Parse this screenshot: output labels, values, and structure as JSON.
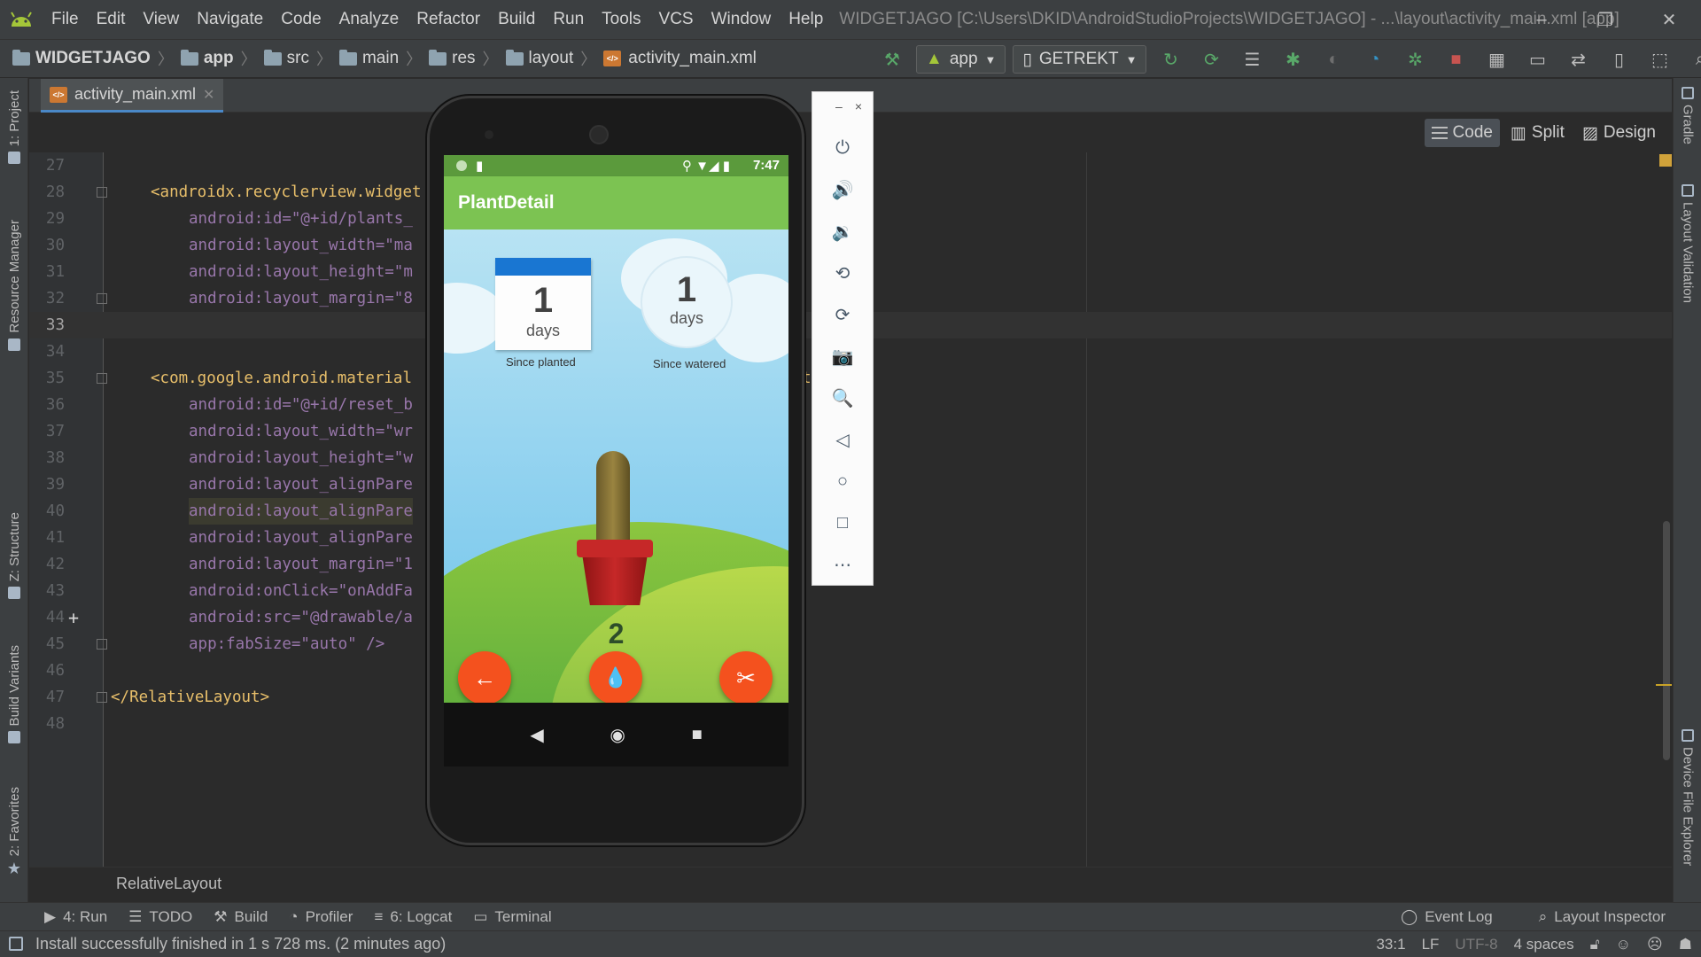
{
  "menubar": {
    "items": [
      "File",
      "Edit",
      "View",
      "Navigate",
      "Code",
      "Analyze",
      "Refactor",
      "Build",
      "Run",
      "Tools",
      "VCS",
      "Window",
      "Help"
    ],
    "title": "WIDGETJAGO [C:\\Users\\DKID\\AndroidStudioProjects\\WIDGETJAGO] - ...\\layout\\activity_main.xml [app]",
    "minimize": "–",
    "restore": "❐",
    "close": "✕"
  },
  "navbar": {
    "crumbs": [
      "WIDGETJAGO",
      "app",
      "src",
      "main",
      "res",
      "layout",
      "activity_main.xml"
    ],
    "run_config": "app",
    "device": "GETREKT"
  },
  "tabs": {
    "file_tab": "activity_main.xml",
    "close_x": "✕"
  },
  "view_switch": {
    "code": "Code",
    "split": "Split",
    "design": "Design"
  },
  "left_strip": {
    "project": "1: Project",
    "resource_manager": "Resource Manager",
    "structure": "Z: Structure",
    "build_variants": "Build Variants",
    "favorites": "2: Favorites"
  },
  "right_strip": {
    "gradle": "Gradle",
    "layout_validation": "Layout Validation",
    "device_file_explorer": "Device File Explorer"
  },
  "code": {
    "lines": [
      {
        "n": "27",
        "t": ""
      },
      {
        "n": "28",
        "t": "<androidx.recyclerview.widget"
      },
      {
        "n": "29",
        "t": "android:id=\"@+id/plants_"
      },
      {
        "n": "30",
        "t": "android:layout_width=\"ma"
      },
      {
        "n": "31",
        "t": "android:layout_height=\"m"
      },
      {
        "n": "32",
        "t": "android:layout_margin=\"8"
      },
      {
        "n": "33",
        "t": ""
      },
      {
        "n": "34",
        "t": ""
      },
      {
        "n": "35",
        "t": "<com.google.android.material"
      },
      {
        "n": "36",
        "t": "android:id=\"@+id/reset_b"
      },
      {
        "n": "37",
        "t": "android:layout_width=\"wr"
      },
      {
        "n": "38",
        "t": "android:layout_height=\"w"
      },
      {
        "n": "39",
        "t": "android:layout_alignPare"
      },
      {
        "n": "40",
        "t": "android:layout_alignPare"
      },
      {
        "n": "41",
        "t": "android:layout_alignPare"
      },
      {
        "n": "42",
        "t": "android:layout_margin=\"1"
      },
      {
        "n": "43",
        "t": "android:onClick=\"onAddFa"
      },
      {
        "n": "44",
        "t": "android:src=\"@drawable/a"
      },
      {
        "n": "45",
        "t": "app:fabSize=\"auto\" />"
      },
      {
        "n": "46",
        "t": ""
      },
      {
        "n": "47",
        "t": "</RelativeLayout>"
      },
      {
        "n": "48",
        "t": ""
      }
    ],
    "stray_char": "t"
  },
  "breadcrumb": "RelativeLayout",
  "toolwindows": {
    "run": "4: Run",
    "todo": "TODO",
    "build": "Build",
    "profiler": "Profiler",
    "logcat": "6: Logcat",
    "terminal": "Terminal",
    "event_log": "Event Log",
    "layout_inspector": "Layout Inspector"
  },
  "statusbar": {
    "message": "Install successfully finished in 1 s 728 ms. (2 minutes ago)",
    "position": "33:1",
    "line_sep": "LF",
    "encoding": "UTF-8",
    "indent": "4 spaces"
  },
  "phone": {
    "time": "7:47",
    "app_title": "PlantDetail",
    "planted_number": "1",
    "planted_unit": "days",
    "planted_caption": "Since planted",
    "watered_number": "1",
    "watered_unit": "days",
    "watered_caption": "Since watered",
    "plant_count": "2",
    "back_fab": "←",
    "water_fab": "💧",
    "cut_fab": "✂",
    "nav_back": "◀",
    "nav_home": "◉",
    "nav_recents": "■"
  },
  "emulator_tools": {
    "min": "–",
    "close": "×",
    "buttons": [
      "⏻",
      "🔊",
      "🔉",
      "⟲",
      "⟳",
      "📷",
      "🔍",
      "◁",
      "○",
      "□",
      "⋯"
    ]
  },
  "colors": {
    "accent_orange": "#f4511e",
    "appbar_green": "#7cc352",
    "calendar_blue": "#1976d2"
  }
}
